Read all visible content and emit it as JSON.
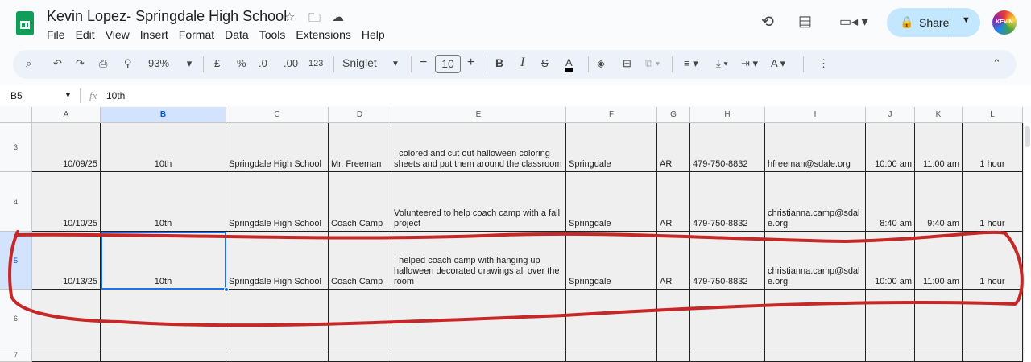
{
  "doc": {
    "title": "Kevin Lopez- Springdale High School"
  },
  "menu": [
    "File",
    "Edit",
    "View",
    "Insert",
    "Format",
    "Data",
    "Tools",
    "Extensions",
    "Help"
  ],
  "toolbar": {
    "zoom": "93%",
    "currency": "£",
    "percent": "%",
    "dec_dec": ".0",
    "inc_dec": ".00",
    "format": "123",
    "font": "Sniglet",
    "font_size": "10",
    "bold": "B",
    "italic": "I"
  },
  "share": {
    "label": "Share"
  },
  "avatar": {
    "text": "KEVIN"
  },
  "formula": {
    "cell_ref": "B5",
    "fx": "fx",
    "value": "10th"
  },
  "columns": [
    "A",
    "B",
    "C",
    "D",
    "E",
    "F",
    "G",
    "H",
    "I",
    "J",
    "K",
    "L"
  ],
  "rows": [
    {
      "num": "3",
      "cells": [
        "10/09/25",
        "10th",
        "Springdale High School",
        "Mr. Freeman",
        "I colored and cut out halloween coloring sheets and put them around the classroom",
        "Springdale",
        "AR",
        "479-750-8832",
        "hfreeman@sdale.org",
        "10:00 am",
        "11:00 am",
        "1 hour"
      ]
    },
    {
      "num": "4",
      "cells": [
        "10/10/25",
        "10th",
        "Springdale High School",
        "Coach Camp",
        "Volunteered to help coach camp with a fall project",
        "Springdale",
        "AR",
        "479-750-8832",
        "christianna.camp@sdale.org",
        "8:40 am",
        "9:40 am",
        "1 hour"
      ]
    },
    {
      "num": "5",
      "cells": [
        "10/13/25",
        "10th",
        "Springdale High School",
        "Coach Camp",
        "I helped coach camp with hanging up halloween decorated drawings all over the room",
        "Springdale",
        "AR",
        "479-750-8832",
        "christianna.camp@sdale.org",
        "10:00 am",
        "11:00 am",
        "1 hour"
      ]
    },
    {
      "num": "6",
      "cells": [
        "",
        "",
        "",
        "",
        "",
        "",
        "",
        "",
        "",
        "",
        "",
        ""
      ]
    },
    {
      "num": "7",
      "cells": [
        "",
        "",
        "",
        "",
        "",
        "",
        "",
        "",
        "",
        "",
        "",
        ""
      ]
    }
  ]
}
